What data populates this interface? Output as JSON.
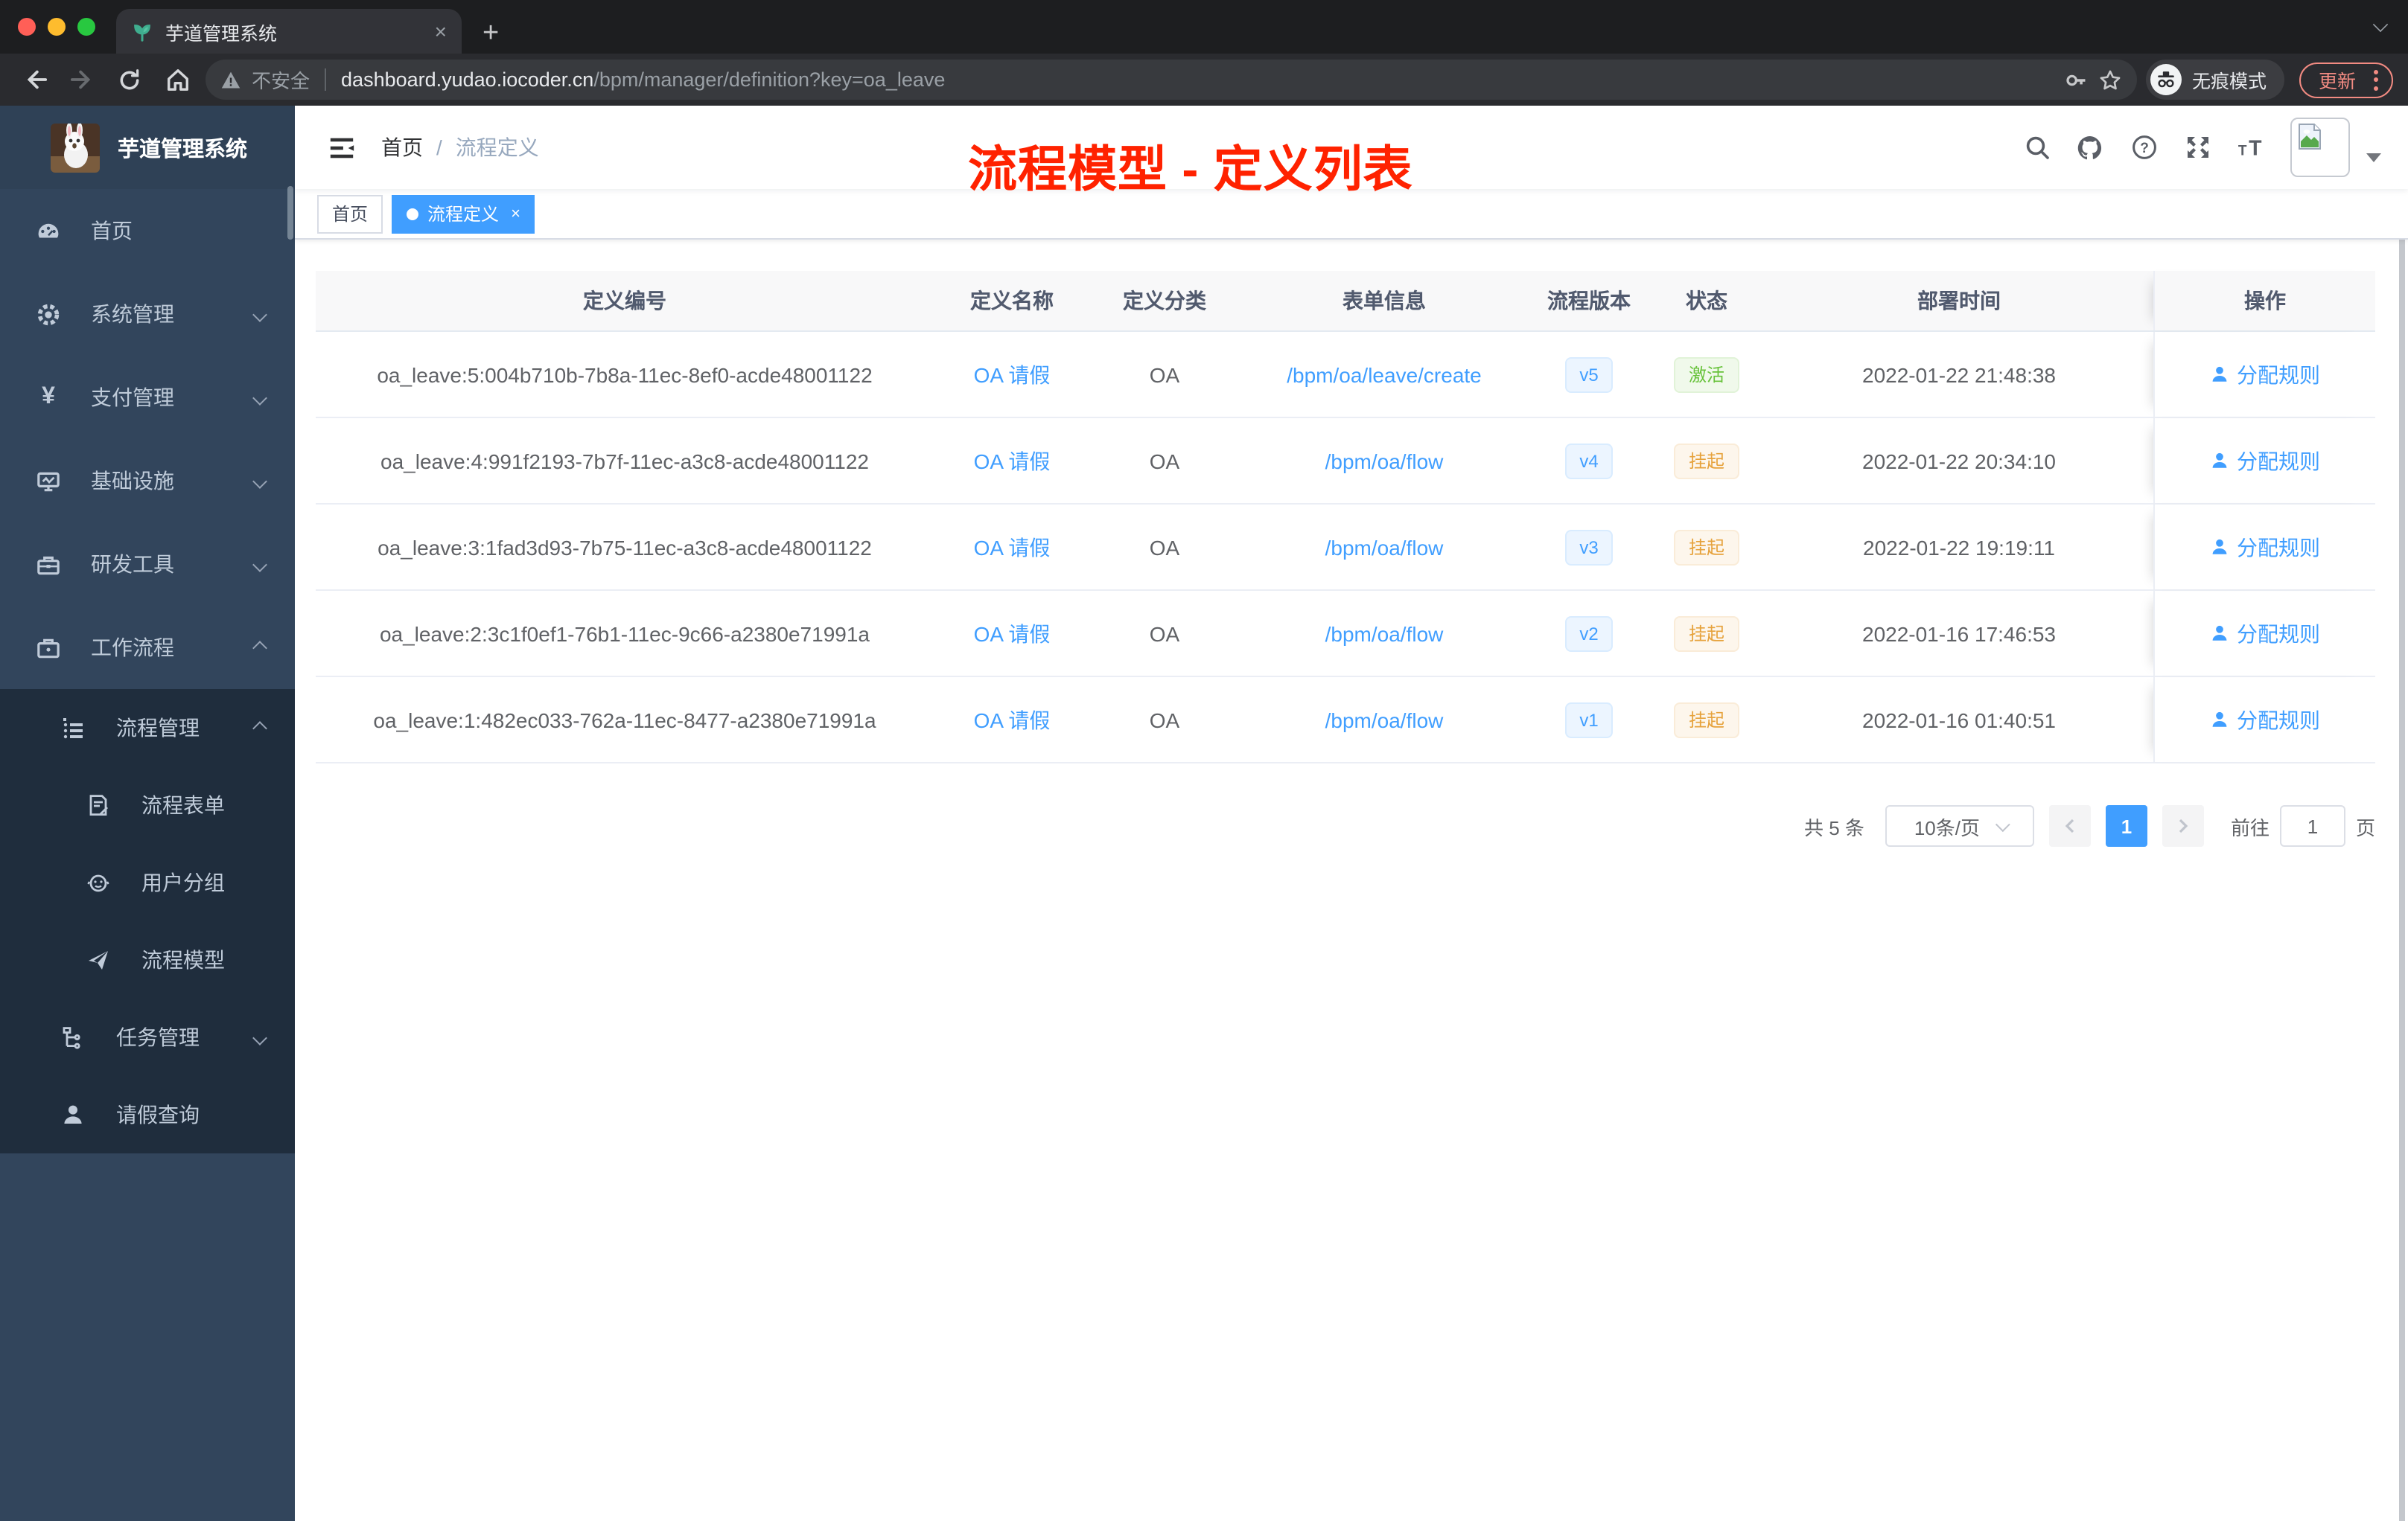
{
  "browser": {
    "tab_title": "芋道管理系统",
    "tab_close": "×",
    "new_tab": "+",
    "security_label": "不安全",
    "url_host": "dashboard.yudao.iocoder.cn",
    "url_path": "/bpm/manager/definition?key=oa_leave",
    "incognito_label": "无痕模式",
    "update_label": "更新"
  },
  "annotation": {
    "title": "流程模型 - 定义列表",
    "color": "#ff2200"
  },
  "sidebar": {
    "app_title": "芋道管理系统",
    "items": [
      {
        "label": "首页"
      },
      {
        "label": "系统管理"
      },
      {
        "label": "支付管理"
      },
      {
        "label": "基础设施"
      },
      {
        "label": "研发工具"
      },
      {
        "label": "工作流程"
      }
    ],
    "submenu": [
      {
        "label": "流程管理"
      },
      {
        "label": "流程表单"
      },
      {
        "label": "用户分组"
      },
      {
        "label": "流程模型"
      },
      {
        "label": "任务管理"
      },
      {
        "label": "请假查询"
      }
    ]
  },
  "navbar": {
    "breadcrumb_home": "首页",
    "breadcrumb_sep": "/",
    "breadcrumb_current": "流程定义"
  },
  "tags": {
    "home": "首页",
    "active": "流程定义",
    "close": "×"
  },
  "table": {
    "headers": {
      "id": "定义编号",
      "name": "定义名称",
      "category": "定义分类",
      "form": "表单信息",
      "version": "流程版本",
      "status": "状态",
      "deploy_time": "部署时间",
      "action": "操作"
    },
    "rows": [
      {
        "id": "oa_leave:5:004b710b-7b8a-11ec-8ef0-acde48001122",
        "name": "OA 请假",
        "category": "OA",
        "form": "/bpm/oa/leave/create",
        "version": "v5",
        "status": "激活",
        "status_type": "success",
        "deploy_time": "2022-01-22 21:48:38",
        "action": "分配规则"
      },
      {
        "id": "oa_leave:4:991f2193-7b7f-11ec-a3c8-acde48001122",
        "name": "OA 请假",
        "category": "OA",
        "form": "/bpm/oa/flow",
        "version": "v4",
        "status": "挂起",
        "status_type": "warning",
        "deploy_time": "2022-01-22 20:34:10",
        "action": "分配规则"
      },
      {
        "id": "oa_leave:3:1fad3d93-7b75-11ec-a3c8-acde48001122",
        "name": "OA 请假",
        "category": "OA",
        "form": "/bpm/oa/flow",
        "version": "v3",
        "status": "挂起",
        "status_type": "warning",
        "deploy_time": "2022-01-22 19:19:11",
        "action": "分配规则"
      },
      {
        "id": "oa_leave:2:3c1f0ef1-76b1-11ec-9c66-a2380e71991a",
        "name": "OA 请假",
        "category": "OA",
        "form": "/bpm/oa/flow",
        "version": "v2",
        "status": "挂起",
        "status_type": "warning",
        "deploy_time": "2022-01-16 17:46:53",
        "action": "分配规则"
      },
      {
        "id": "oa_leave:1:482ec033-762a-11ec-8477-a2380e71991a",
        "name": "OA 请假",
        "category": "OA",
        "form": "/bpm/oa/flow",
        "version": "v1",
        "status": "挂起",
        "status_type": "warning",
        "deploy_time": "2022-01-16 01:40:51",
        "action": "分配规则"
      }
    ]
  },
  "pagination": {
    "total": "共 5 条",
    "page_size": "10条/页",
    "page": "1",
    "goto": "前往",
    "goto_value": "1",
    "unit": "页"
  },
  "colors": {
    "accent": "#409eff",
    "success": "#67c23a",
    "warning": "#e6a23c",
    "sidebar_bg": "#32455c",
    "submenu_bg": "#1f2d3d",
    "annotation_red": "#ff2200"
  }
}
